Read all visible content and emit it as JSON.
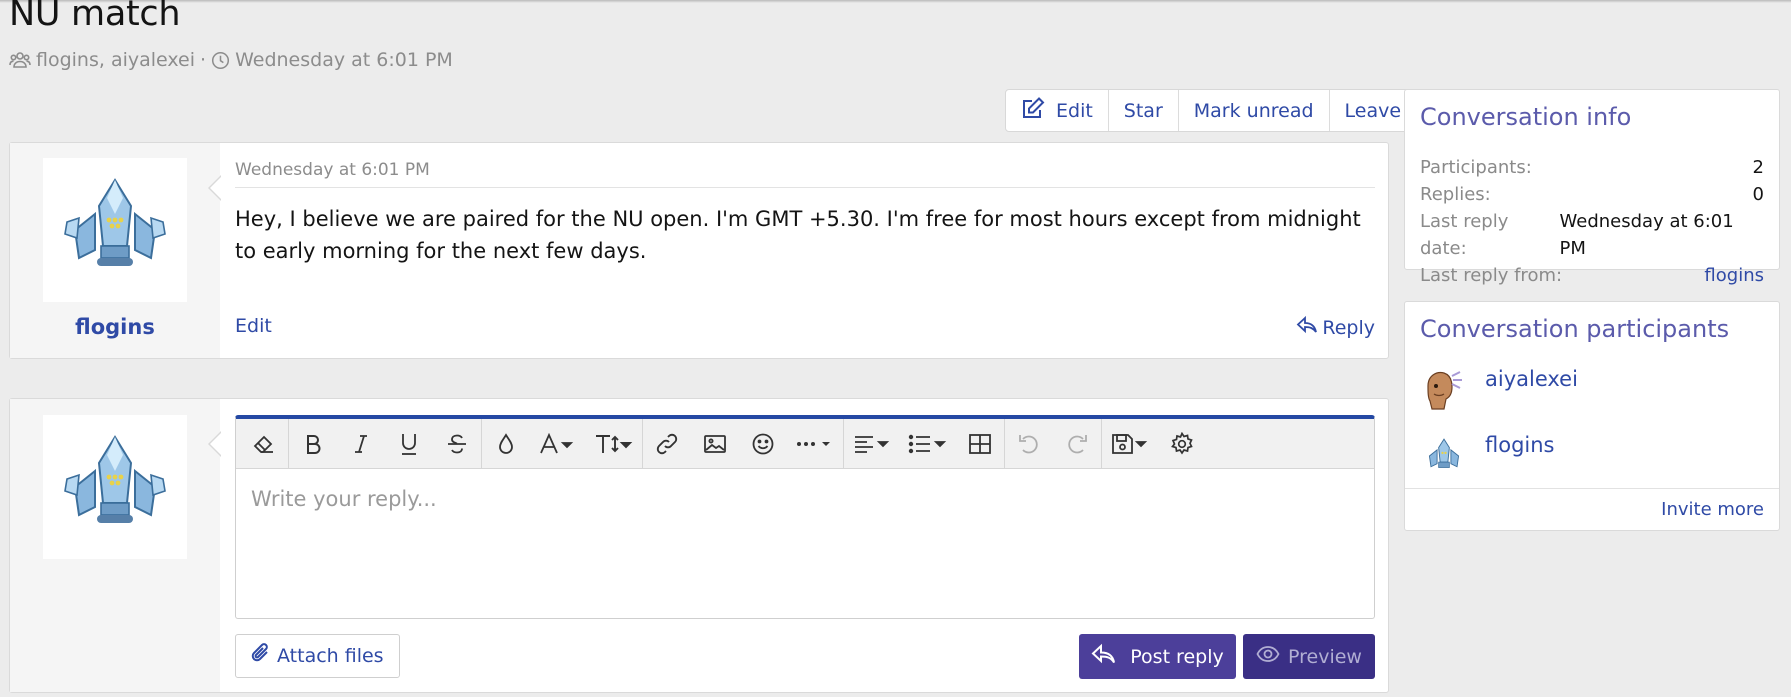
{
  "page": {
    "title": "NU match",
    "participants_text": "flogins, aiyalexei",
    "separator": "·",
    "date": "Wednesday at 6:01 PM"
  },
  "actions": {
    "edit": "Edit",
    "star": "Star",
    "mark_unread": "Mark unread",
    "leave": "Leave"
  },
  "message": {
    "author": "flogins",
    "date": "Wednesday at 6:01 PM",
    "body": "Hey, I believe we are paired for the NU open. I'm GMT +5.30. I'm free for most hours except from midnight to early morning for the next few days.",
    "edit_label": "Edit",
    "reply_label": "Reply"
  },
  "reply_form": {
    "placeholder": "Write your reply...",
    "attach_label": "Attach files",
    "post_label": "Post reply",
    "preview_label": "Preview",
    "toolbar": [
      "eraser-icon",
      "bold-icon",
      "italic-icon",
      "underline-icon",
      "strikethrough-icon",
      "text-color-icon",
      "font-family-icon",
      "font-size-icon",
      "link-icon",
      "image-icon",
      "emoji-icon",
      "more-icon",
      "align-icon",
      "list-icon",
      "table-icon",
      "undo-icon",
      "redo-icon",
      "drafts-icon",
      "settings-icon"
    ]
  },
  "conversation_info": {
    "title": "Conversation info",
    "rows": [
      {
        "label": "Participants:",
        "value": "2"
      },
      {
        "label": "Replies:",
        "value": "0"
      },
      {
        "label": "Last reply date:",
        "value": "Wednesday at 6:01 PM"
      },
      {
        "label": "Last reply from:",
        "value": "flogins"
      }
    ]
  },
  "conversation_participants": {
    "title": "Conversation participants",
    "people": [
      "aiyalexei",
      "flogins"
    ],
    "invite_label": "Invite more"
  },
  "colors": {
    "link": "#2f4aa6",
    "heading": "#5b5bab",
    "primary_button": "#4c3f9a",
    "editor_accent": "#2448a3"
  }
}
